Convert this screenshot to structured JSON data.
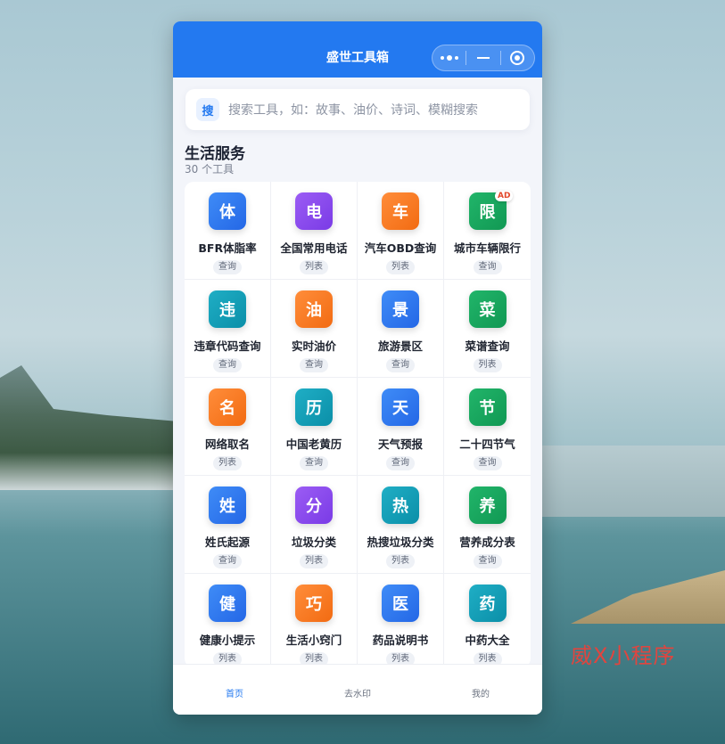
{
  "watermark": "威X小程序",
  "window": {
    "title": "盛世工具箱",
    "capsule": {
      "more_icon": "more-dots-icon",
      "minimize_icon": "minus-icon",
      "close_icon": "target-circle-icon"
    }
  },
  "search": {
    "icon_label": "搜",
    "placeholder": "搜索工具，如：故事、油价、诗词、模糊搜索"
  },
  "section": {
    "title": "生活服务",
    "count": "30 个工具"
  },
  "tools": [
    {
      "char": "体",
      "name": "BFR体脂率",
      "tag": "查询",
      "color": "blue"
    },
    {
      "char": "电",
      "name": "全国常用电话",
      "tag": "列表",
      "color": "purple"
    },
    {
      "char": "车",
      "name": "汽车OBD查询",
      "tag": "列表",
      "color": "orange"
    },
    {
      "char": "限",
      "name": "城市车辆限行",
      "tag": "查询",
      "color": "green",
      "badge": "AD"
    },
    {
      "char": "违",
      "name": "违章代码查询",
      "tag": "查询",
      "color": "teal"
    },
    {
      "char": "油",
      "name": "实时油价",
      "tag": "查询",
      "color": "orange"
    },
    {
      "char": "景",
      "name": "旅游景区",
      "tag": "查询",
      "color": "blue"
    },
    {
      "char": "菜",
      "name": "菜谱查询",
      "tag": "列表",
      "color": "green"
    },
    {
      "char": "名",
      "name": "网络取名",
      "tag": "列表",
      "color": "orange"
    },
    {
      "char": "历",
      "name": "中国老黄历",
      "tag": "查询",
      "color": "teal"
    },
    {
      "char": "天",
      "name": "天气预报",
      "tag": "查询",
      "color": "blue"
    },
    {
      "char": "节",
      "name": "二十四节气",
      "tag": "查询",
      "color": "green"
    },
    {
      "char": "姓",
      "name": "姓氏起源",
      "tag": "查询",
      "color": "blue"
    },
    {
      "char": "分",
      "name": "垃圾分类",
      "tag": "列表",
      "color": "purple"
    },
    {
      "char": "热",
      "name": "热搜垃圾分类",
      "tag": "列表",
      "color": "teal"
    },
    {
      "char": "养",
      "name": "营养成分表",
      "tag": "查询",
      "color": "green"
    },
    {
      "char": "健",
      "name": "健康小提示",
      "tag": "列表",
      "color": "blue"
    },
    {
      "char": "巧",
      "name": "生活小窍门",
      "tag": "列表",
      "color": "orange"
    },
    {
      "char": "医",
      "name": "药品说明书",
      "tag": "列表",
      "color": "blue"
    },
    {
      "char": "药",
      "name": "中药大全",
      "tag": "列表",
      "color": "teal"
    }
  ],
  "tabbar": [
    {
      "label": "首页",
      "active": true
    },
    {
      "label": "去水印",
      "active": false
    },
    {
      "label": "我的",
      "active": false
    }
  ]
}
